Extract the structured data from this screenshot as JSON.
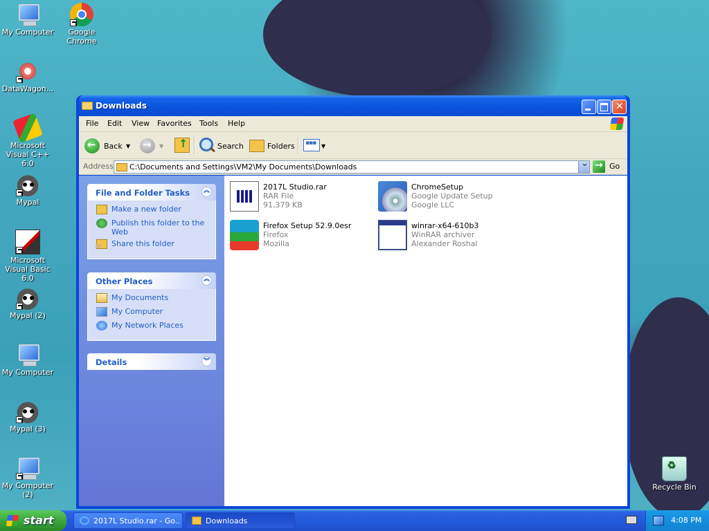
{
  "desktop": {
    "icons": [
      {
        "label": "My Computer"
      },
      {
        "label": "Google Chrome"
      },
      {
        "label": "DataWagon..."
      },
      {
        "label": "Microsoft Visual C++ 6.0"
      },
      {
        "label": "Mypal"
      },
      {
        "label": "Microsoft Visual Basic 6.0"
      },
      {
        "label": "Mypal (2)"
      },
      {
        "label": "My Computer"
      },
      {
        "label": "Mypal (3)"
      },
      {
        "label": "My Computer (2)"
      },
      {
        "label": "Recycle Bin"
      }
    ]
  },
  "window": {
    "title": "Downloads",
    "menu": [
      "File",
      "Edit",
      "View",
      "Favorites",
      "Tools",
      "Help"
    ],
    "toolbar": {
      "back": "Back",
      "search": "Search",
      "folders": "Folders"
    },
    "address": {
      "label": "Address",
      "path": "C:\\Documents and Settings\\VM2\\My Documents\\Downloads",
      "go": "Go"
    },
    "tasks": {
      "file_folder": {
        "title": "File and Folder Tasks",
        "items": [
          "Make a new folder",
          "Publish this folder to the Web",
          "Share this folder"
        ]
      },
      "other_places": {
        "title": "Other Places",
        "items": [
          "My Documents",
          "My Computer",
          "My Network Places"
        ]
      },
      "details": {
        "title": "Details"
      }
    },
    "files": [
      {
        "name": "2017L Studio.rar",
        "line2": "RAR File",
        "line3": "91,379 KB"
      },
      {
        "name": "ChromeSetup",
        "line2": "Google Update Setup",
        "line3": "Google LLC"
      },
      {
        "name": "Firefox Setup 52.9.0esr",
        "line2": "Firefox",
        "line3": "Mozilla"
      },
      {
        "name": "winrar-x64-610b3",
        "line2": "WinRAR archiver",
        "line3": "Alexander Roshal"
      }
    ]
  },
  "taskbar": {
    "start": "start",
    "tasks": [
      {
        "label": "2017L Studio.rar - Go..."
      },
      {
        "label": "Downloads"
      }
    ],
    "clock": "4:08 PM"
  }
}
